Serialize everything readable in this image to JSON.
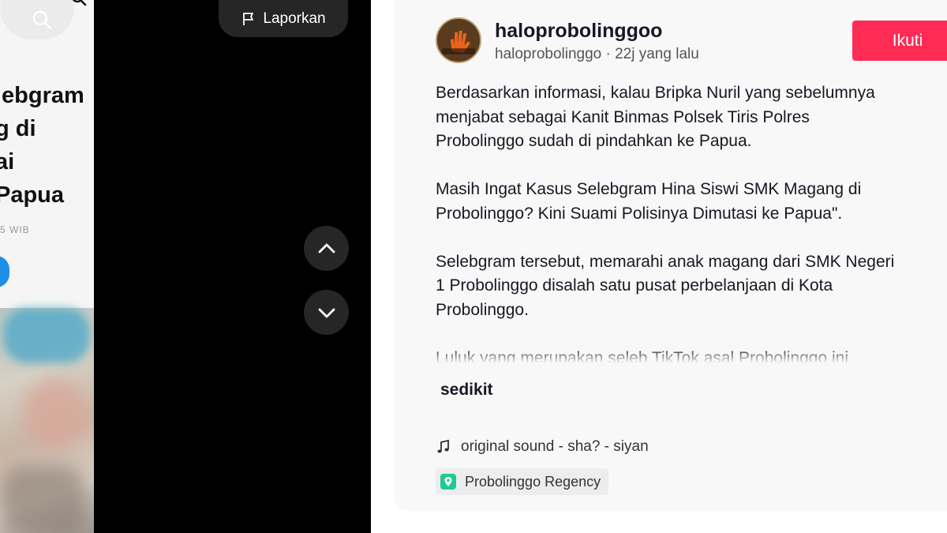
{
  "video": {
    "phone": {
      "headline_lines": [
        "lebgram",
        "g di",
        "ai",
        "Papua"
      ],
      "timestamp": "5 WIB"
    },
    "report_label": "Laporkan"
  },
  "post": {
    "username": "haloprobolinggoo",
    "meta": "haloprobolinggo · 22j yang lalu",
    "follow_label": "Ikuti",
    "caption_paragraphs": [
      [
        "Berdasarkan informasi, kalau Bripka Nuril yang sebelumnya",
        "menjabat sebagai Kanit Binmas Polsek Tiris Polres",
        "Probolinggo sudah di pindahkan ke Papua."
      ],
      [
        "Masih Ingat Kasus Selebgram Hina Siswi SMK Magang di",
        "Probolinggo? Kini Suami Polisinya Dimutasi ke Papua\"."
      ],
      [
        "Selebgram tersebut, memarahi anak magang dari SMK Negeri",
        "1 Probolinggo disalah satu pusat perbelanjaan di Kota",
        "Probolinggo."
      ],
      [
        "Luluk yang merupakan seleb TikTok asal Probolinggo ini,"
      ]
    ],
    "more_label": "sedikit",
    "music": "original sound - sha? - siyan",
    "location": "Probolinggo Regency"
  },
  "colors": {
    "follow_button": "#fe2c55",
    "location_icon": "#20c997",
    "control_bg": "#262626"
  },
  "icons": {
    "report": "flag-icon",
    "up": "chevron-up-icon",
    "down": "chevron-down-icon",
    "music": "music-note-icon",
    "location": "location-pin-icon"
  }
}
